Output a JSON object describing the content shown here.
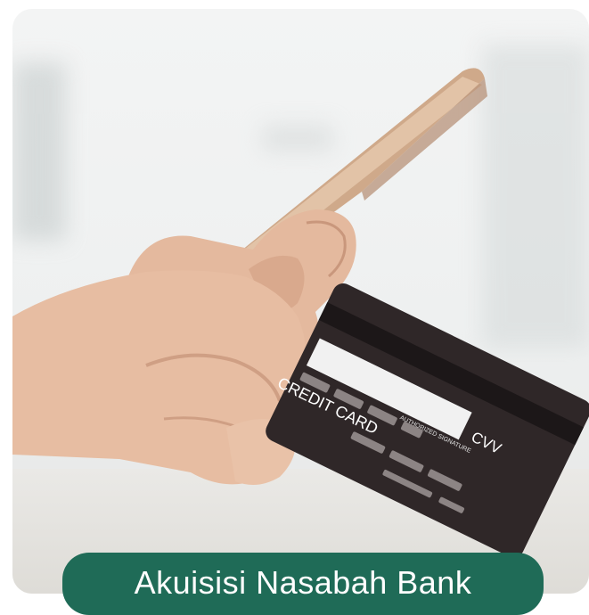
{
  "card": {
    "cvv_label": "CVV",
    "credit_card_label": "CREDIT CARD",
    "signature_label": "AUTHORIZED SIGNATURE"
  },
  "banner": {
    "title": "Akuisisi Nasabah Bank"
  },
  "colors": {
    "banner_bg": "#1f6b57",
    "card_bg": "#2f2728",
    "background": "#f3f4f4"
  }
}
